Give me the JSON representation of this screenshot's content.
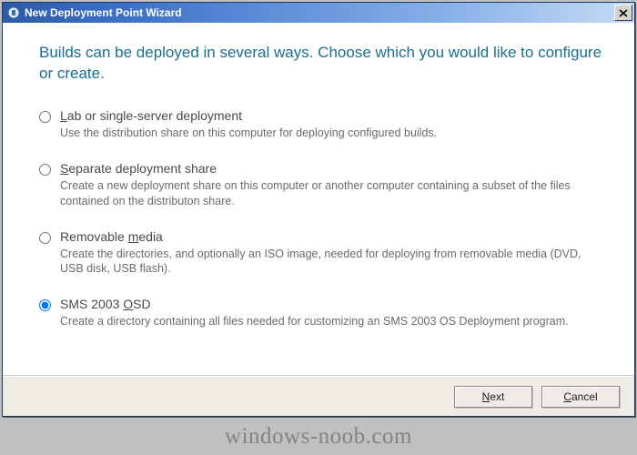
{
  "window": {
    "title": "New Deployment Point Wizard"
  },
  "heading": "Builds can be deployed in several ways. Choose which you would like to configure or create.",
  "options": [
    {
      "label_pre": "",
      "label_mn": "L",
      "label_post": "ab or single-server deployment",
      "desc": "Use the distribution share on this computer for deploying configured builds.",
      "selected": false
    },
    {
      "label_pre": "",
      "label_mn": "S",
      "label_post": "eparate deployment share",
      "desc": "Create a new deployment share on this computer or another computer containing a subset of the files contained on the distributon share.",
      "selected": false
    },
    {
      "label_pre": "Removable ",
      "label_mn": "m",
      "label_post": "edia",
      "desc": "Create the directories, and optionally an ISO image, needed for deploying from removable media (DVD, USB disk, USB flash).",
      "selected": false
    },
    {
      "label_pre": "SMS 2003 ",
      "label_mn": "O",
      "label_post": "SD",
      "desc": "Create a directory containing all files needed for customizing an SMS 2003 OS Deployment program.",
      "selected": true
    }
  ],
  "buttons": {
    "next_pre": "",
    "next_mn": "N",
    "next_post": "ext",
    "cancel_pre": "",
    "cancel_mn": "C",
    "cancel_post": "ancel"
  },
  "watermark": "windows-noob.com"
}
